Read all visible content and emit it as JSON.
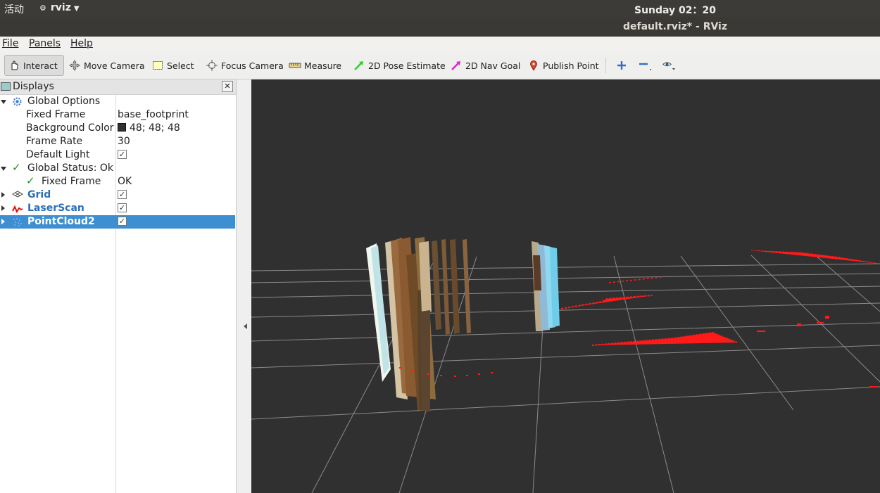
{
  "system": {
    "activities": "活动",
    "app_name": "rviz",
    "clock": "Sunday 02：20"
  },
  "window": {
    "title": "default.rviz* - RViz"
  },
  "menu": {
    "file": "File",
    "panels": "Panels",
    "help": "Help"
  },
  "toolbar": {
    "interact": "Interact",
    "move_camera": "Move Camera",
    "select": "Select",
    "focus_camera": "Focus Camera",
    "measure": "Measure",
    "pose_estimate": "2D Pose Estimate",
    "nav_goal": "2D Nav Goal",
    "publish_point": "Publish Point"
  },
  "displays": {
    "title": "Displays",
    "global_options": {
      "label": "Global Options",
      "fixed_frame_label": "Fixed Frame",
      "fixed_frame_value": "base_footprint",
      "background_color_label": "Background Color",
      "background_color_value": "48; 48; 48",
      "frame_rate_label": "Frame Rate",
      "frame_rate_value": "30",
      "default_light_label": "Default Light"
    },
    "global_status": {
      "label": "Global Status: Ok",
      "fixed_frame_label": "Fixed Frame",
      "fixed_frame_value": "OK"
    },
    "items": [
      {
        "label": "Grid",
        "checked": true
      },
      {
        "label": "LaserScan",
        "checked": true
      },
      {
        "label": "PointCloud2",
        "checked": true,
        "selected": true
      }
    ]
  },
  "colors": {
    "background": "#303030",
    "grid": "#a0a0a0",
    "laser": "#ff1a1a",
    "selection": "#3d8fd1"
  }
}
